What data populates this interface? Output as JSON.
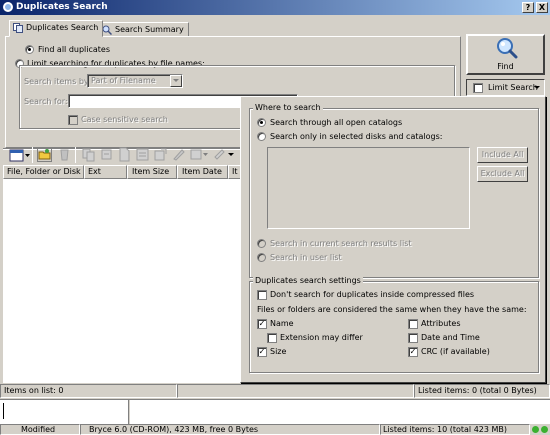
{
  "window": {
    "title": "Duplicates Search",
    "help_button": "?",
    "close_button": "X"
  },
  "tabs": [
    {
      "label": "Duplicates Search",
      "icon": "duplicates-icon"
    },
    {
      "label": "Search Summary",
      "icon": "summary-icon"
    }
  ],
  "search_mode": {
    "find_all_label": "Find all duplicates",
    "limit_label": "Limit searching for duplicates by file names:",
    "search_items_by_label": "Search items by:",
    "search_items_by_value": "Part of Filename",
    "search_for_label": "Search for:",
    "search_for_value": "",
    "case_sensitive_label": "Case sensitive search"
  },
  "find_button": {
    "label": "Find",
    "icon": "magnifier-icon"
  },
  "limit_search": {
    "label": "Limit Search",
    "icon": "dropdown-arrow-icon"
  },
  "where_to_search": {
    "group_label": "Where to search",
    "option_all_catalogs": "Search through all open catalogs",
    "option_selected": "Search only in selected disks and catalogs:",
    "include_all": "Include All",
    "exclude_all": "Exclude All",
    "option_results": "Search in current search results list",
    "option_user_list": "Search in user list"
  },
  "dup_settings": {
    "group_label": "Duplicates search settings",
    "dont_search_compressed": "Don't search for duplicates inside compressed files",
    "same_when_label": "Files or folders are considered the same when they have the same:",
    "name": "Name",
    "extension_may_differ": "Extension may differ",
    "size": "Size",
    "attributes": "Attributes",
    "date_time": "Date and Time",
    "crc": "CRC (if available)",
    "checked": {
      "dont_search_compressed": false,
      "name": true,
      "extension_may_differ": false,
      "size": true,
      "attributes": false,
      "date_time": false,
      "crc": true
    }
  },
  "results_table": {
    "columns": [
      "File, Folder or Disk",
      "Ext",
      "Item Size",
      "Item Date",
      "It"
    ]
  },
  "status": {
    "items_on_list": "Items on list: 0",
    "listed_items": "Listed items: 0 (total 0 Bytes)"
  },
  "bottom_status": {
    "modified": "Modified",
    "disk_info": "Bryce 6.0 (CD-ROM), 423 MB, free 0 Bytes",
    "listed_items": "Listed items: 10 (total 423 MB)"
  }
}
